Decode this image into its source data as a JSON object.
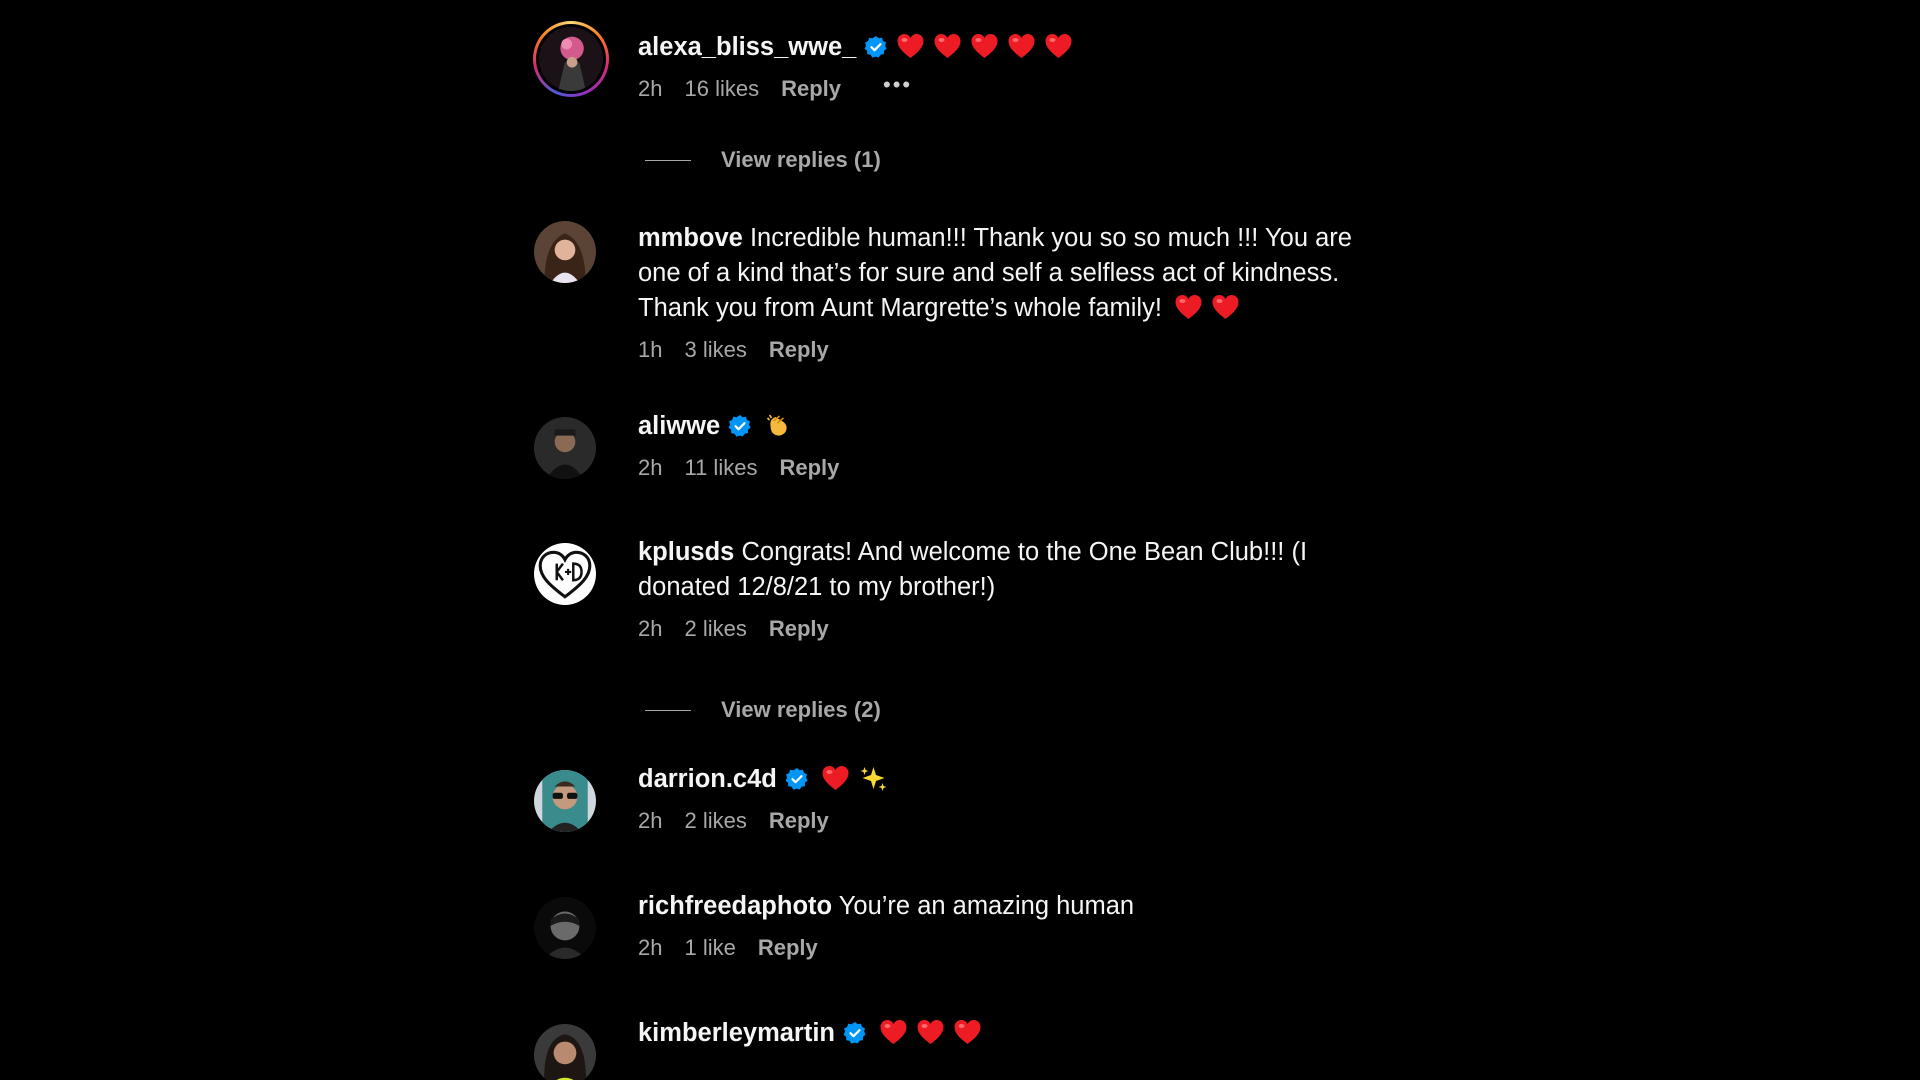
{
  "comments": [
    {
      "username": "alexa_bliss_wwe_",
      "verified": true,
      "text": "",
      "emoji": [
        "heart",
        "heart",
        "heart",
        "heart",
        "heart"
      ],
      "time": "2h",
      "likes": "16 likes",
      "reply_label": "Reply",
      "more": "•••",
      "view_replies": "View replies (1)"
    },
    {
      "username": "mmbove",
      "verified": false,
      "text": "Incredible human!!! Thank you so so much !!! You are one of a kind that’s for sure and self a selfless act of kindness. Thank you from Aunt Margrette’s whole family!",
      "emoji": [
        "heart",
        "heart"
      ],
      "time": "1h",
      "likes": "3 likes",
      "reply_label": "Reply"
    },
    {
      "username": "aliwwe",
      "verified": true,
      "text": "",
      "emoji": [
        "clapping-hands"
      ],
      "time": "2h",
      "likes": "11 likes",
      "reply_label": "Reply"
    },
    {
      "username": "kplusds",
      "verified": false,
      "text": "Congrats! And welcome to the One Bean Club!!! (I donated 12/8/21 to my brother!)",
      "emoji": [],
      "time": "2h",
      "likes": "2 likes",
      "reply_label": "Reply",
      "view_replies": "View replies (2)"
    },
    {
      "username": "darrion.c4d",
      "verified": true,
      "text": "",
      "emoji": [
        "heart",
        "sparkles"
      ],
      "time": "2h",
      "likes": "2 likes",
      "reply_label": "Reply"
    },
    {
      "username": "richfreedaphoto",
      "verified": false,
      "text": "You’re an amazing human",
      "emoji": [],
      "time": "2h",
      "likes": "1 like",
      "reply_label": "Reply"
    },
    {
      "username": "kimberleymartin",
      "verified": true,
      "text": "",
      "emoji": [
        "heart",
        "heart",
        "heart"
      ],
      "time": "",
      "likes": "",
      "reply_label": ""
    }
  ],
  "colors": {
    "background": "#000000",
    "text": "#f5f5f5",
    "meta": "#a8a8a8",
    "verified": "#0095f6",
    "heart": "#ed1c24"
  }
}
